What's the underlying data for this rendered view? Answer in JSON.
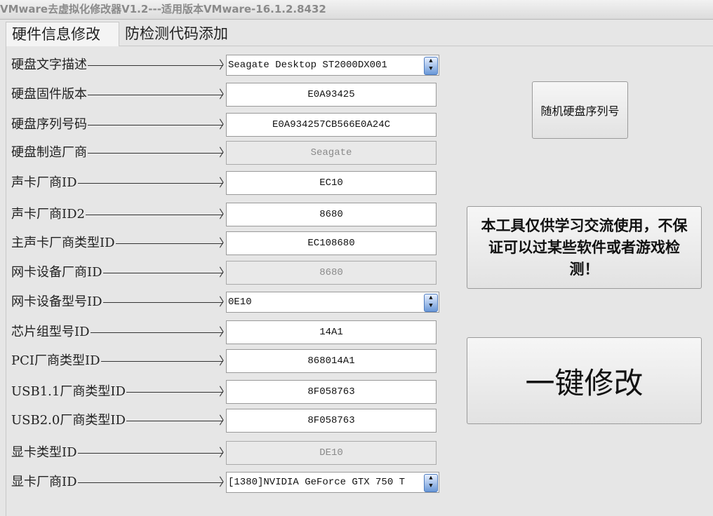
{
  "window": {
    "title": "VMware去虚拟化修改器V1.2---适用版本VMware-16.1.2.8432"
  },
  "tabs": [
    {
      "label": "硬件信息修改",
      "active": true
    },
    {
      "label": "防检测代码添加",
      "active": false
    }
  ],
  "rows": [
    {
      "label": "硬盘文字描述",
      "value": "Seagate Desktop ST2000DX001",
      "type": "select"
    },
    {
      "label": "硬盘固件版本",
      "value": "E0A93425",
      "type": "input"
    },
    {
      "label": "硬盘序列号码",
      "value": "E0A934257CB566E0A24C",
      "type": "input"
    },
    {
      "label": "硬盘制造厂商",
      "value": "Seagate",
      "type": "disabled"
    },
    {
      "label": "声卡厂商ID",
      "value": "EC10",
      "type": "input"
    },
    {
      "label": "声卡厂商ID2",
      "value": "8680",
      "type": "input"
    },
    {
      "label": "主声卡厂商类型ID",
      "value": "EC108680",
      "type": "input"
    },
    {
      "label": "网卡设备厂商ID",
      "value": "8680",
      "type": "disabled"
    },
    {
      "label": "网卡设备型号ID",
      "value": "0E10",
      "type": "select"
    },
    {
      "label": "芯片组型号ID",
      "value": "14A1",
      "type": "input"
    },
    {
      "label": "PCI厂商类型ID",
      "value": "868014A1",
      "type": "input"
    },
    {
      "label": "USB1.1厂商类型ID",
      "value": "8F058763",
      "type": "input"
    },
    {
      "label": "USB2.0厂商类型ID",
      "value": "8F058763",
      "type": "input"
    },
    {
      "label": "显卡类型ID",
      "value": "DE10",
      "type": "disabled"
    },
    {
      "label": "显卡厂商ID",
      "value": "[1380]NVIDIA GeForce GTX 750 T",
      "type": "select"
    }
  ],
  "buttons": {
    "random_serial": "随机硬盘序列号",
    "notice": "本工具仅供学习交流使用，不保证可以过某些软件或者游戏检测！",
    "apply": "一键修改"
  }
}
